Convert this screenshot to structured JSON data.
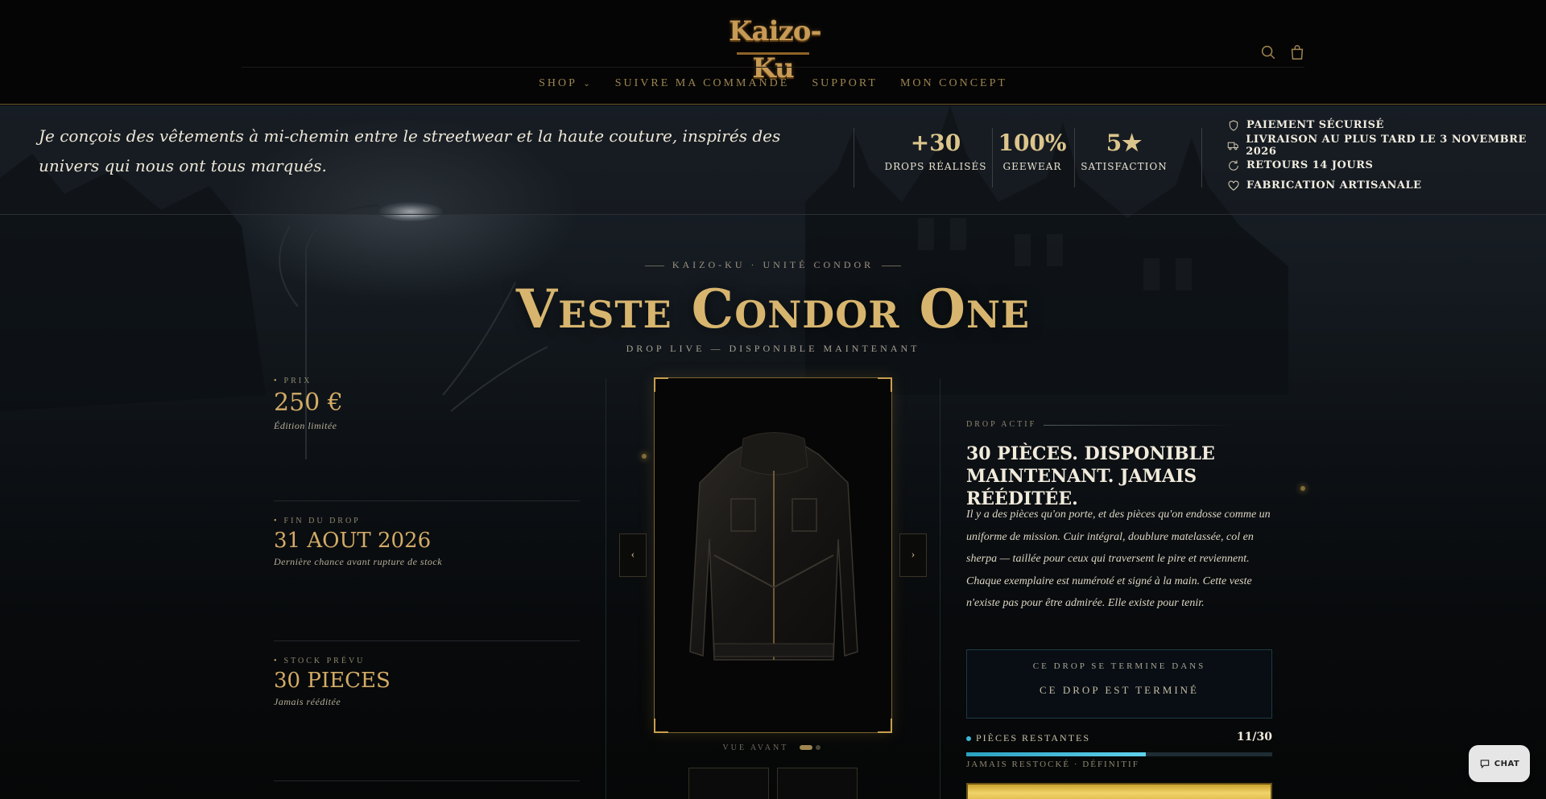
{
  "brand": {
    "logo_text": "Kaizo-Ku"
  },
  "nav": {
    "items": [
      {
        "label": "SHOP",
        "dropdown": true
      },
      {
        "label": "SUIVRE MA COMMANDE"
      },
      {
        "label": "SUPPORT"
      },
      {
        "label": "MON CONCEPT"
      }
    ],
    "search_icon": "search-icon",
    "cart_icon": "cart-icon"
  },
  "band": {
    "quote": "Je conçois des vêtements à mi-chemin entre le streetwear et la haute couture, inspirés des univers qui nous ont tous marqués.",
    "stats": [
      {
        "value": "+30",
        "label": "DROPS RÉALISÉS"
      },
      {
        "value": "100%",
        "label": "GEEWEAR"
      },
      {
        "value": "5★",
        "label": "SATISFACTION"
      }
    ],
    "trust": [
      {
        "icon": "shield-icon",
        "label": "PAIEMENT SÉCURISÉ"
      },
      {
        "icon": "truck-icon",
        "label": "LIVRAISON AU PLUS TARD LE 3 NOVEMBRE 2026"
      },
      {
        "icon": "refresh-icon",
        "label": "RETOURS 14 JOURS"
      },
      {
        "icon": "heart-icon",
        "label": "FABRICATION ARTISANALE"
      }
    ]
  },
  "product": {
    "kicker": "KAIZO-KU · UNITÉ CONDOR",
    "title": "Veste Condor One",
    "subtitle": "DROP LIVE — DISPONIBLE MAINTENANT",
    "specs": [
      {
        "label": "PRIX",
        "value": "250 €",
        "note": "Édition limitée"
      },
      {
        "label": "FIN DU DROP",
        "value": "31 AOUT 2026",
        "note": "Dernière chance avant rupture de stock"
      },
      {
        "label": "STOCK PRÉVU",
        "value": "30 PIECES",
        "note": "Jamais rééditée"
      }
    ],
    "gallery": {
      "prev": "‹",
      "next": "›",
      "view_label": "VUE AVANT",
      "active_index": 0,
      "count": 2
    },
    "drop_label": "DROP ACTIF",
    "headline": "30 PIÈCES. DISPONIBLE MAINTENANT. JAMAIS RÉÉDITÉE.",
    "description": "Il y a des pièces qu'on porte, et des pièces qu'on endosse comme un uniforme de mission. Cuir intégral, doublure matelassée, col en sherpa — taillée pour ceux qui traversent le pire et reviennent. Chaque exemplaire est numéroté et signé à la main. Cette veste n'existe pas pour être admirée. Elle existe pour tenir.",
    "countdown": {
      "label": "CE DROP SE TERMINE DANS",
      "status": "CE DROP EST TERMINÉ"
    },
    "stock": {
      "label": "PIÈCES RESTANTES",
      "count": "11/30",
      "remaining": 11,
      "total": 30,
      "note": "JAMAIS RESTOCKÉ · DÉFINITIF"
    }
  },
  "chat": {
    "label": "CHAT"
  },
  "colors": {
    "gold": "#d7b56e",
    "accent_blue": "#3fb6d5",
    "background": "#060606"
  }
}
